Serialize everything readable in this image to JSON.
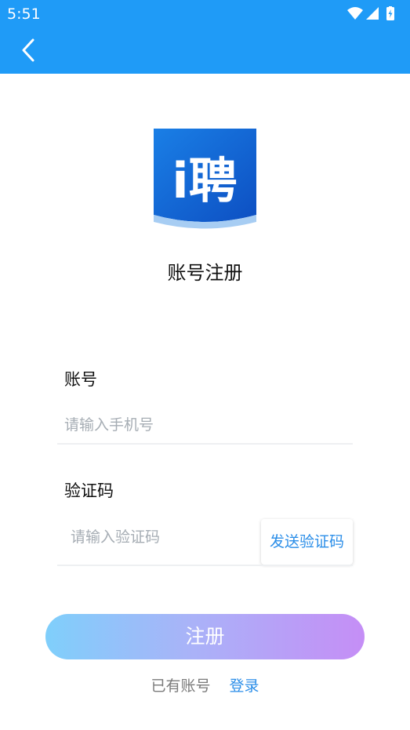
{
  "status_bar": {
    "time": "5:51"
  },
  "colors": {
    "primary": "#1f9bf7",
    "link": "#2b8ee8",
    "gradient_start": "#7fcffb",
    "gradient_end": "#c58ef6"
  },
  "icons": {
    "back": "chevron-left-icon",
    "wifi": "wifi-icon",
    "signal": "signal-icon",
    "battery": "battery-icon"
  },
  "logo": {
    "text": "i聘"
  },
  "page_title": "账号注册",
  "account": {
    "label": "账号",
    "placeholder": "请输入手机号",
    "value": ""
  },
  "code": {
    "label": "验证码",
    "placeholder": "请输入验证码",
    "value": "",
    "send_label": "发送验证码"
  },
  "register_label": "注册",
  "footer": {
    "prompt": "已有账号",
    "login_label": "登录"
  }
}
